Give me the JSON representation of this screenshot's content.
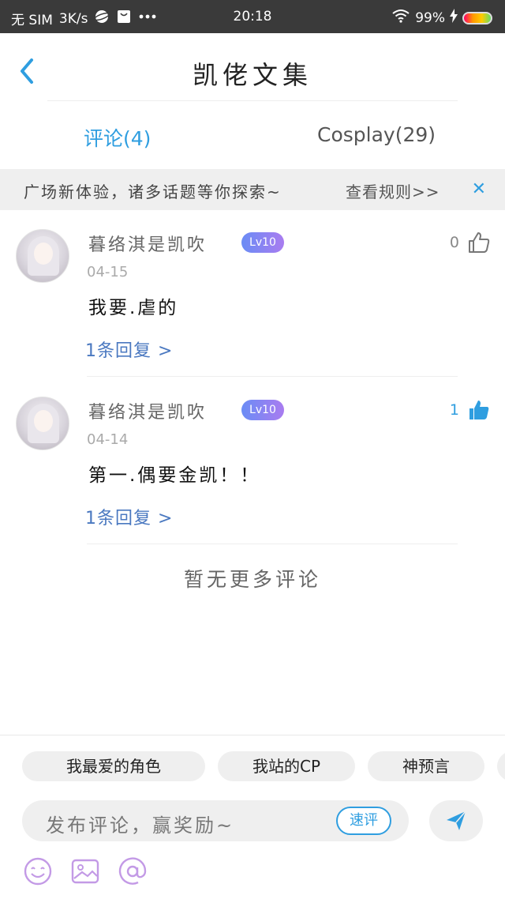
{
  "status_bar": {
    "carrier": "无 SIM",
    "speed": "3K/s",
    "time": "20:18",
    "battery": "99%",
    "icons": [
      "planet-icon",
      "bag-icon",
      "more-icon",
      "wifi-icon",
      "charging-icon",
      "battery-icon"
    ]
  },
  "header": {
    "title": "凯佬文集",
    "back_icon": "chevron-left-icon"
  },
  "tabs": [
    {
      "label": "评论(4)",
      "active": true
    },
    {
      "label": "Cosplay(29)",
      "active": false
    }
  ],
  "notice": {
    "text": "广场新体验，诸多话题等你探索~",
    "link": "查看规则>>",
    "close": "✕"
  },
  "comments": [
    {
      "username": "暮络淇是凯吹",
      "level": "Lv10",
      "date": "04-15",
      "content": "我要.虐的",
      "replies": "1条回复 >",
      "likes": "0",
      "liked": false
    },
    {
      "username": "暮络淇是凯吹",
      "level": "Lv10",
      "date": "04-14",
      "content": "第一.偶要金凯！！",
      "replies": "1条回复 >",
      "likes": "1",
      "liked": true
    }
  ],
  "footer_text": "暂无更多评论",
  "bottom": {
    "chips": [
      "我最爱的角色",
      "我站的CP",
      "神预言"
    ],
    "input_placeholder": "发布评论，赢奖励~",
    "quick_comment": "速评",
    "tools": [
      "emoji-icon",
      "image-icon",
      "at-icon"
    ]
  },
  "colors": {
    "accent": "#2f9ee0",
    "link": "#4a78c0",
    "level_start": "#6a8cf5",
    "level_end": "#a97cf0"
  }
}
